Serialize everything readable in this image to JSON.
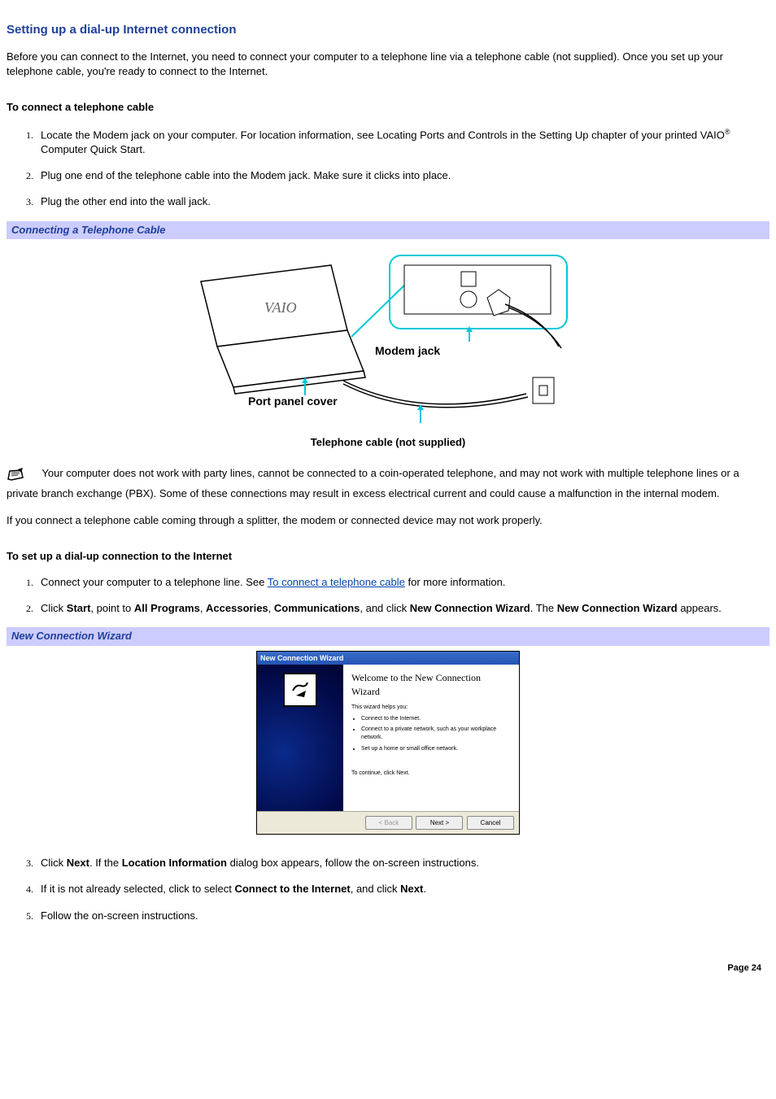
{
  "heading": "Setting up a dial-up Internet connection",
  "intro": "Before you can connect to the Internet, you need to connect your computer to a telephone line via a telephone cable (not supplied). Once you set up your telephone cable, you're ready to connect to the Internet.",
  "sect1": {
    "title": "To connect a telephone cable",
    "steps": {
      "s1a": "Locate the Modem jack on your computer. For location information, see Locating Ports and Controls in the Setting Up chapter of your printed VAIO",
      "s1reg": "®",
      "s1b": " Computer Quick Start.",
      "s2": "Plug one end of the telephone cable into the Modem jack. Make sure it clicks into place.",
      "s3": "Plug the other end into the wall jack."
    }
  },
  "band1": "Connecting a Telephone Cable",
  "fig1": {
    "label_modem": "Modem jack",
    "label_panel": "Port panel cover",
    "caption": "Telephone cable (not supplied)",
    "laptop_text": "VAIO"
  },
  "note1": "Your computer does not work with party lines, cannot be connected to a coin-operated telephone, and may not work with multiple telephone lines or a private branch exchange (PBX). Some of these connections may result in excess electrical current and could cause a malfunction in the internal modem.",
  "note2": "If you connect a telephone cable coming through a splitter, the modem or connected device may not work properly.",
  "sect2": {
    "title": "To set up a dial-up connection to the Internet",
    "steps": {
      "s1a": "Connect your computer to a telephone line. See ",
      "s1link": "To connect a telephone cable",
      "s1b": " for more information.",
      "s2a": "Click ",
      "s2b_start": "Start",
      "s2c": ", point to ",
      "s2d_all": "All Programs",
      "s2e": ", ",
      "s2f_acc": "Accessories",
      "s2g": ", ",
      "s2h_comm": "Communications",
      "s2i": ", and click ",
      "s2j_new": "New Connection Wizard",
      "s2k": ". The ",
      "s2l_new2": "New Connection Wizard",
      "s2m": " appears.",
      "s3a": "Click ",
      "s3b_next": "Next",
      "s3c": ". If the ",
      "s3d_loc": "Location Information",
      "s3e": " dialog box appears, follow the on-screen instructions.",
      "s4a": "If it is not already selected, click to select ",
      "s4b_conn": "Connect to the Internet",
      "s4c": ", and click ",
      "s4d_next": "Next",
      "s4e": ".",
      "s5": "Follow the on-screen instructions."
    }
  },
  "band2": "New Connection Wizard",
  "wizard": {
    "titlebar": "New Connection Wizard",
    "welcome": "Welcome to the New Connection Wizard",
    "helps": "This wizard helps you:",
    "b1": "Connect to the Internet.",
    "b2": "Connect to a private network, such as your workplace network.",
    "b3": "Set up a home or small office network.",
    "cont": "To continue, click Next.",
    "back": "< Back",
    "next": "Next >",
    "cancel": "Cancel"
  },
  "footer": "Page 24"
}
